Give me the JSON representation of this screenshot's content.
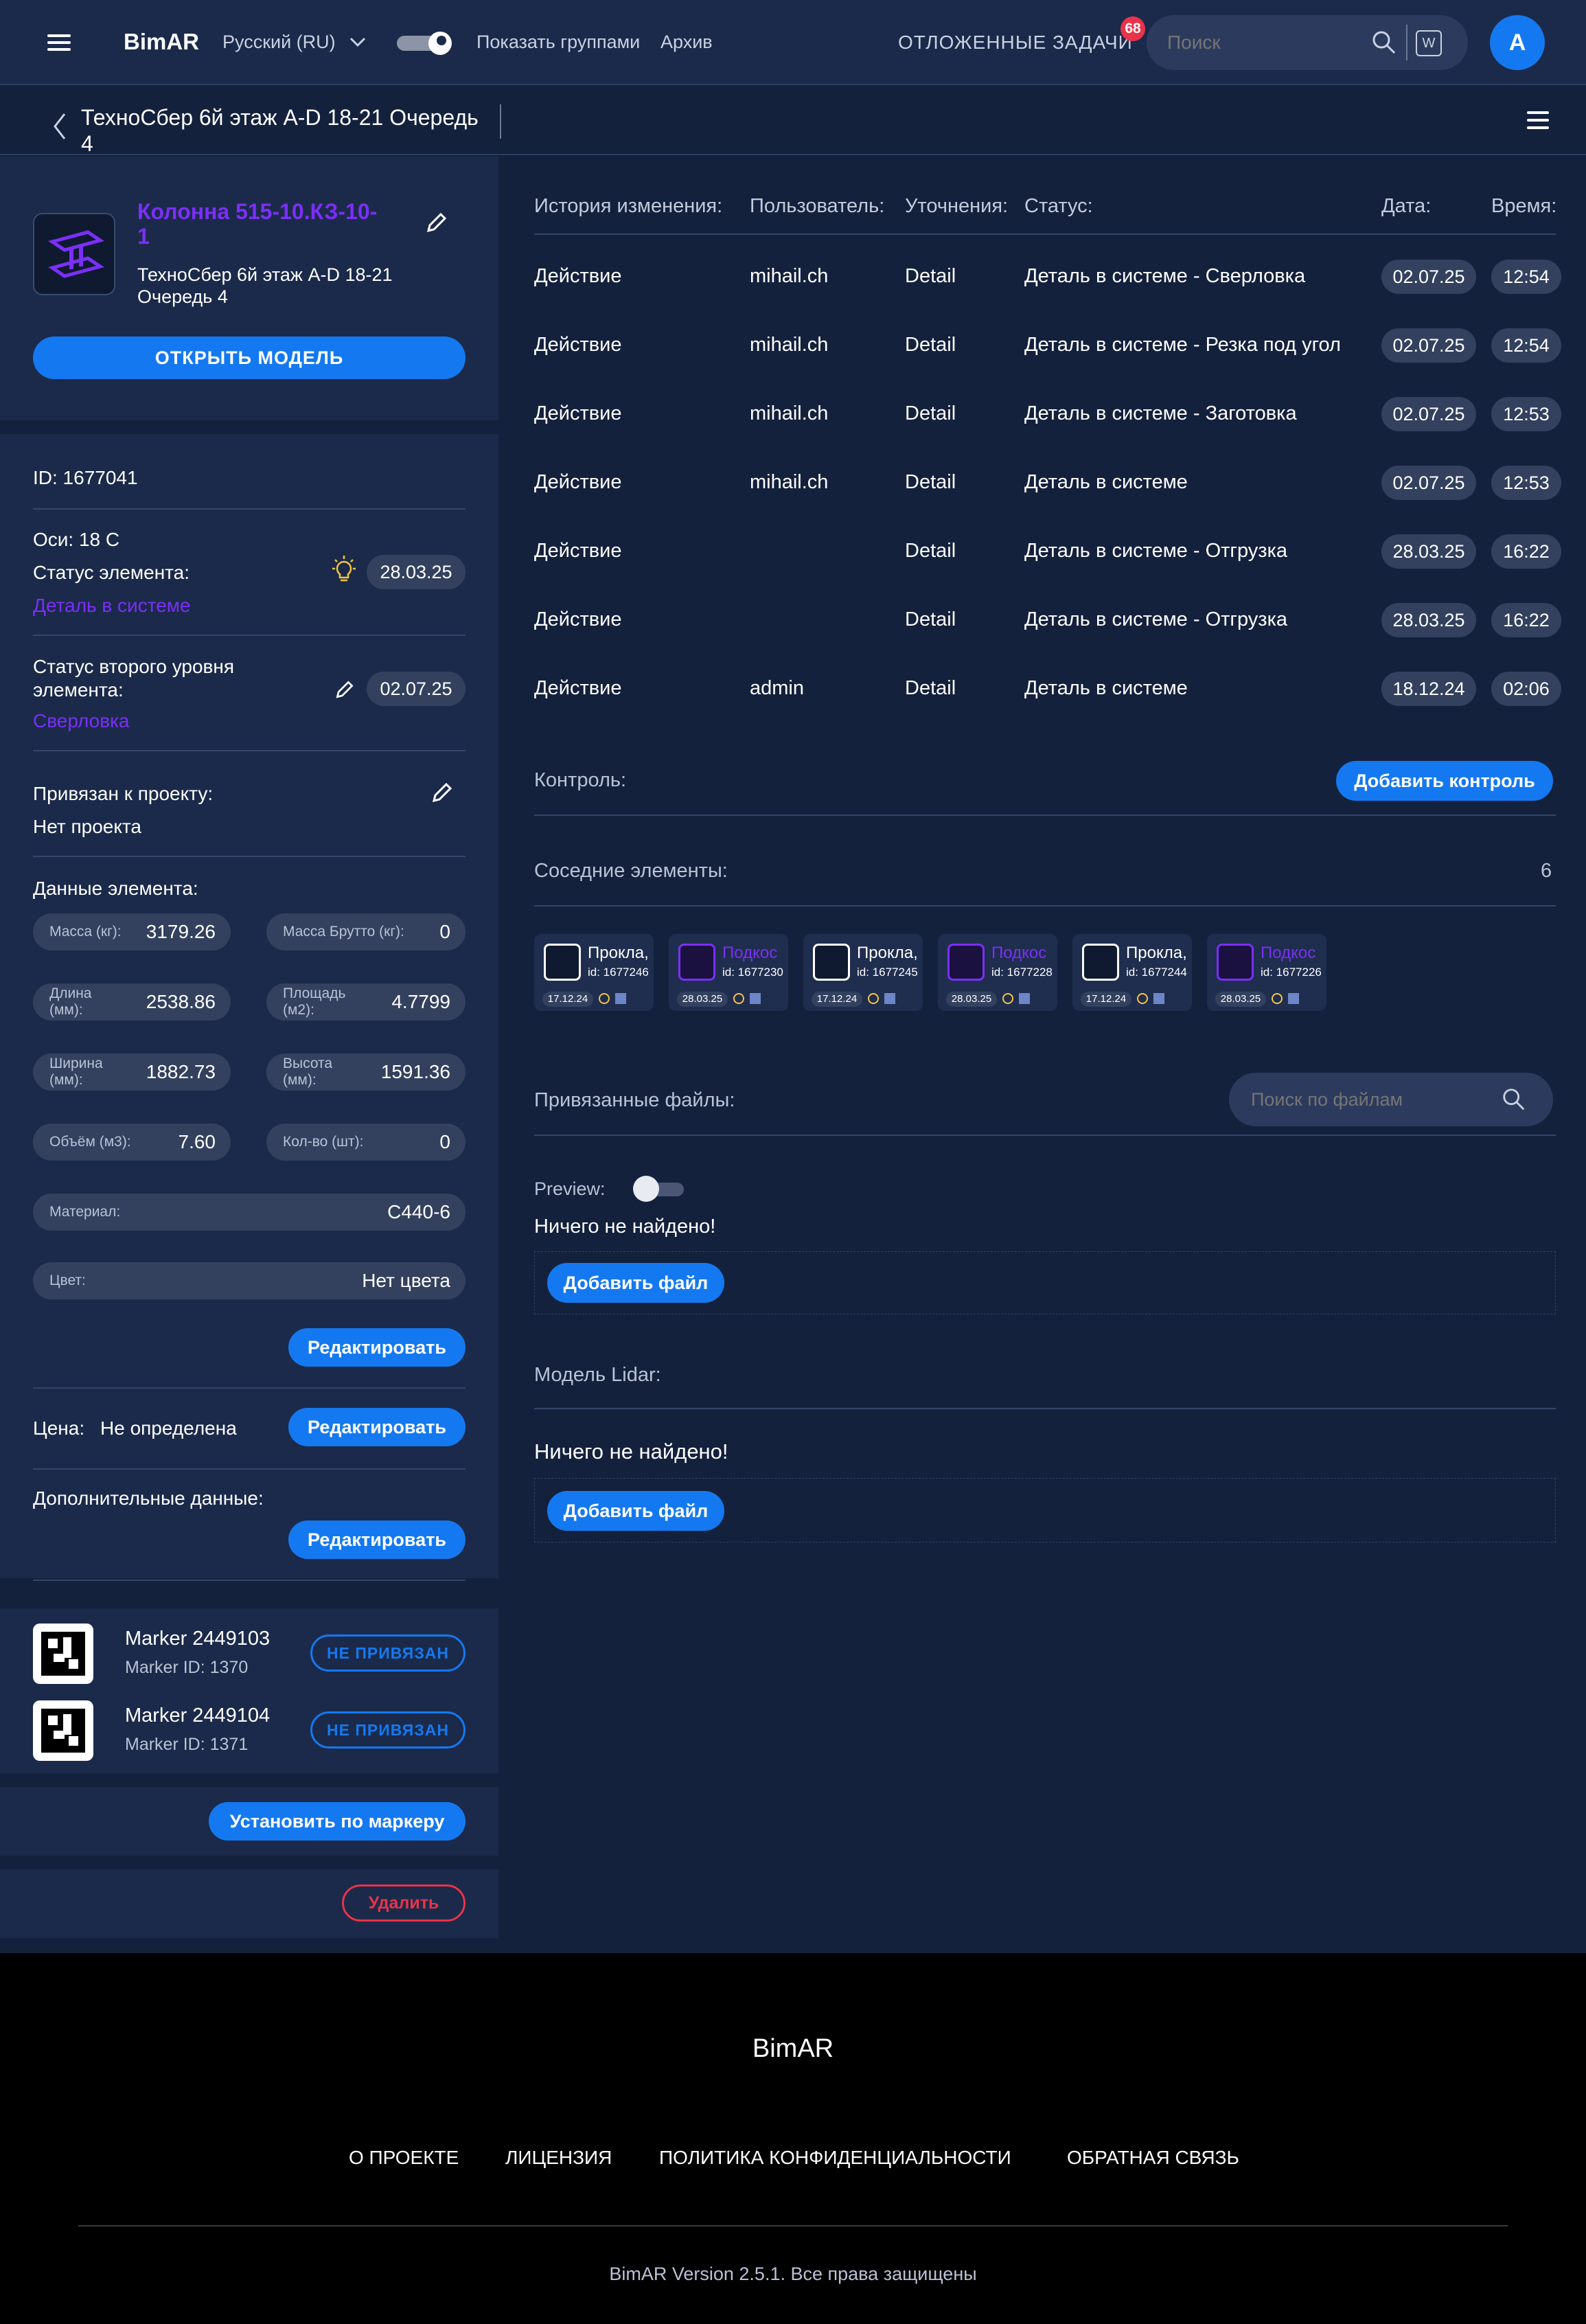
{
  "header": {
    "logo": "BimAR",
    "language": "Русский (RU)",
    "show_groups": "Показать группами",
    "archive": "Архив",
    "deferred_tasks": "ОТЛОЖЕННЫЕ ЗАДАЧИ",
    "deferred_count": "68",
    "search_placeholder": "Поиск",
    "search_key": "W",
    "avatar_letter": "A"
  },
  "subheader": {
    "title_line1": "ТехноСбер 6й этаж A-D 18-21 Очередь",
    "title_line2": "4"
  },
  "element": {
    "name_line1": "Колонна 515-10.КЗ-10-",
    "name_line2": "1",
    "project_line1": "ТехноСбер 6й этаж A-D 18-21",
    "project_line2": "Очередь 4",
    "open_model": "ОТКРЫТЬ МОДЕЛЬ",
    "id_text": "ID: 1677041",
    "axes_text": "Оси: 18 С",
    "status_label": "Статус элемента:",
    "status_value": "Деталь в системе",
    "status_date": "28.03.25",
    "status2_label_line1": "Статус второго уровня",
    "status2_label_line2": "элемента:",
    "status2_value": "Сверловка",
    "status2_date": "02.07.25",
    "project_label": "Привязан к проекту:",
    "project_value": "Нет проекта",
    "data_label": "Данные элемента:",
    "fields": {
      "mass_label": "Масса (кг):",
      "mass_value": "3179.26",
      "gross_label": "Масса Брутто (кг):",
      "gross_value": "0",
      "length_label_1": "Длина",
      "length_label_2": "(мм):",
      "length_value": "2538.86",
      "area_label_1": "Площадь",
      "area_label_2": "(м2):",
      "area_value": "4.7799",
      "width_label_1": "Ширина",
      "width_label_2": "(мм):",
      "width_value": "1882.73",
      "height_label_1": "Высота",
      "height_label_2": "(мм):",
      "height_value": "1591.36",
      "volume_label": "Объём (м3):",
      "volume_value": "7.60",
      "qty_label": "Кол-во (шт):",
      "qty_value": "0",
      "material_label": "Материал:",
      "material_value": "С440-6",
      "color_label": "Цвет:",
      "color_value": "Нет цвета"
    },
    "edit_label": "Редактировать",
    "price_label": "Цена:",
    "price_value": "Не определена",
    "extra_label": "Дополнительные данные:",
    "delete_label": "Удалить",
    "set_by_marker": "Установить по маркеру"
  },
  "markers": [
    {
      "name": "Marker 2449103",
      "id_text": "Marker ID: 1370",
      "status": "НЕ ПРИВЯЗАН"
    },
    {
      "name": "Marker 2449104",
      "id_text": "Marker ID: 1371",
      "status": "НЕ ПРИВЯЗАН"
    }
  ],
  "history": {
    "headers": [
      "История изменения:",
      "Пользователь:",
      "Уточнения:",
      "Статус:",
      "Дата:",
      "Время:"
    ],
    "rows": [
      {
        "action": "Действие",
        "user": "mihail.ch",
        "detail": "Detail",
        "status": "Деталь в системе - Сверловка",
        "date": "02.07.25",
        "time": "12:54"
      },
      {
        "action": "Действие",
        "user": "mihail.ch",
        "detail": "Detail",
        "status": "Деталь в системе - Резка под угол",
        "date": "02.07.25",
        "time": "12:54"
      },
      {
        "action": "Действие",
        "user": "mihail.ch",
        "detail": "Detail",
        "status": "Деталь в системе - Заготовка",
        "date": "02.07.25",
        "time": "12:53"
      },
      {
        "action": "Действие",
        "user": "mihail.ch",
        "detail": "Detail",
        "status": "Деталь в системе",
        "date": "02.07.25",
        "time": "12:53"
      },
      {
        "action": "Действие",
        "user": "",
        "detail": "Detail",
        "status": "Деталь в системе - Отгрузка",
        "date": "28.03.25",
        "time": "16:22"
      },
      {
        "action": "Действие",
        "user": "",
        "detail": "Detail",
        "status": "Деталь в системе - Отгрузка",
        "date": "28.03.25",
        "time": "16:22"
      },
      {
        "action": "Действие",
        "user": "admin",
        "detail": "Detail",
        "status": "Деталь в системе",
        "date": "18.12.24",
        "time": "02:06"
      }
    ]
  },
  "control": {
    "label": "Контроль:",
    "add_button": "Добавить контроль"
  },
  "neighbors": {
    "label": "Соседние элементы:",
    "count": "6",
    "items": [
      {
        "name": "Прокла,",
        "id": "id: 1677246",
        "date": "17.12.24"
      },
      {
        "name": "Подкос",
        "id": "id: 1677230",
        "date": "28.03.25"
      },
      {
        "name": "Прокла,",
        "id": "id: 1677245",
        "date": "17.12.24"
      },
      {
        "name": "Подкос",
        "id": "id: 1677228",
        "date": "28.03.25"
      },
      {
        "name": "Прокла,",
        "id": "id: 1677244",
        "date": "17.12.24"
      },
      {
        "name": "Подкос",
        "id": "id: 1677226",
        "date": "28.03.25"
      }
    ]
  },
  "files": {
    "label": "Привязанные файлы:",
    "search_placeholder": "Поиск по файлам",
    "preview_label": "Preview:",
    "empty_text": "Ничего не найдено!",
    "add_button": "Добавить файл"
  },
  "lidar": {
    "label": "Модель Lidar:",
    "empty_text": "Ничего не найдено!",
    "add_button": "Добавить файл"
  },
  "footer": {
    "logo": "BimAR",
    "links": [
      "О ПРОЕКТЕ",
      "ЛИЦЕНЗИЯ",
      "ПОЛИТИКА КОНФИДЕНЦИАЛЬНОСТИ",
      "ОБРАТНАЯ СВЯЗЬ"
    ],
    "version": "BimAR Version 2.5.1. Все права защищены"
  },
  "colors": {
    "background": "#14213d",
    "panel": "#1b2a4a",
    "accent": "#1479f0",
    "purple": "#7b2ff7",
    "danger": "#e8334a"
  }
}
